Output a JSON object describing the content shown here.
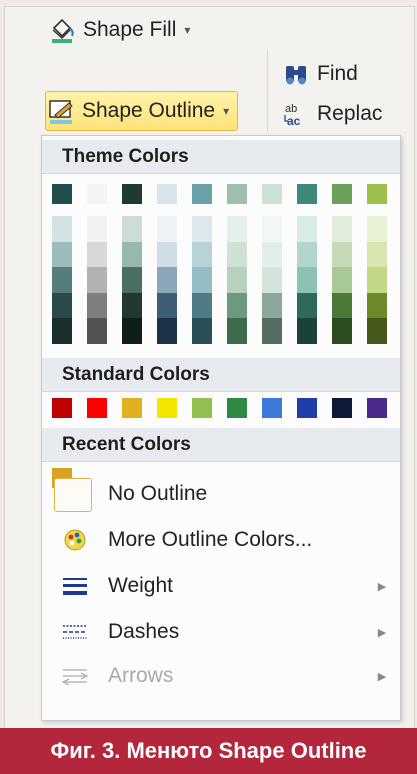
{
  "ribbon": {
    "shape_fill_label": "Shape Fill",
    "shape_outline_label": "Shape Outline",
    "find_label": "Find",
    "replace_label": "Replac"
  },
  "menu": {
    "theme_colors_label": "Theme Colors",
    "standard_colors_label": "Standard Colors",
    "recent_colors_label": "Recent Colors",
    "no_outline_label": "No Outline",
    "more_colors_label": "More Outline Colors...",
    "weight_label": "Weight",
    "dashes_label": "Dashes",
    "arrows_label": "Arrows"
  },
  "caption": "Фиг. 3. Менюто Shape Outline",
  "colors": {
    "theme_top": [
      "#1f4f4a",
      "#f4f4f4",
      "#1d3a30",
      "#d9e4ea",
      "#6aa0a8",
      "#9cc0ac",
      "#cce0d6",
      "#3d8a7a",
      "#6aa058",
      "#9cc04a"
    ],
    "theme_columns": [
      [
        "#d2e2e2",
        "#9cbcbc",
        "#547e7c",
        "#2a4a48",
        "#1a2e2c"
      ],
      [
        "#f2f2f2",
        "#d8d8d8",
        "#b2b2b2",
        "#7e7e7e",
        "#525252"
      ],
      [
        "#cfdcd6",
        "#98b8ac",
        "#4a6e62",
        "#20382e",
        "#0e1e18"
      ],
      [
        "#eef3f6",
        "#d0dde6",
        "#8aa6b8",
        "#3e5e76",
        "#1e3246"
      ],
      [
        "#dbe9ec",
        "#b8d2d8",
        "#94bcc4",
        "#4e7c86",
        "#2a4e56"
      ],
      [
        "#e6efe9",
        "#cfe0d4",
        "#b8d0c0",
        "#6c9a7e",
        "#3e6a4e"
      ],
      [
        "#f2f7f4",
        "#e4eee8",
        "#d4e4da",
        "#8ca69a",
        "#566e62"
      ],
      [
        "#d8ebe6",
        "#b2d6cc",
        "#8cc2b2",
        "#2e6a5c",
        "#1a423a"
      ],
      [
        "#e2ecdc",
        "#c6dab8",
        "#a8c896",
        "#4c7838",
        "#2c4e1e"
      ],
      [
        "#eaf2d6",
        "#d6e6ae",
        "#c2d886",
        "#6e8a28",
        "#46581a"
      ]
    ],
    "standard": [
      "#c00000",
      "#ff0000",
      "#e0b020",
      "#f5e600",
      "#92c050",
      "#2e8a40",
      "#3c7ad8",
      "#1e3fa8",
      "#0e1a3a",
      "#4a2a8a"
    ],
    "recent": [
      "#d9a320"
    ],
    "caption_bg": "#b4263c",
    "highlight_bg": "#fde37a"
  }
}
